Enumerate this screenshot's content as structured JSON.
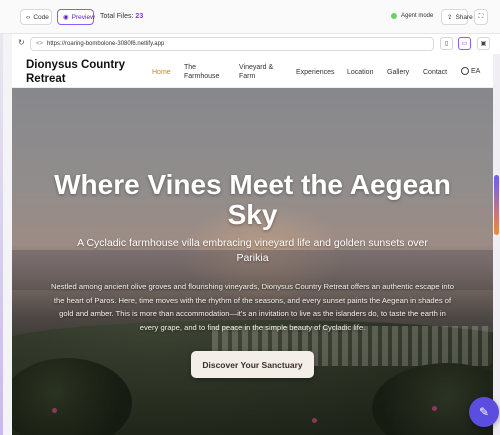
{
  "toolbar": {
    "code_label": "Code",
    "preview_label": "Preview",
    "files_label": "Total Files:",
    "files_count": "23",
    "agent_label": "Agent mode",
    "share_label": "Share"
  },
  "browser": {
    "url": "https://roaring-bombolone-3080f6.netlify.app"
  },
  "site": {
    "brand": "Dionysus Country Retreat",
    "nav": {
      "home": "Home",
      "farmhouse": "The Farmhouse",
      "vineyard": "Vineyard & Farm",
      "experiences": "Experiences",
      "location": "Location",
      "gallery": "Gallery",
      "contact": "Contact",
      "language": "EA"
    },
    "active_color": "#c8862a"
  },
  "hero": {
    "title": "Where Vines Meet the Aegean Sky",
    "subtitle": "A Cycladic farmhouse villa embracing vineyard life and golden sunsets over Parikia",
    "body": "Nestled among ancient olive groves and flourishing vineyards, Dionysus Country Retreat offers an authentic escape into the heart of Paros. Here, time moves with the rhythm of the seasons, and every sunset paints the Aegean in shades of gold and amber. This is more than accommodation—it's an invitation to live as the islanders do, to taste the earth in every grape, and to find peace in the simple beauty of Cycladic life.",
    "cta_label": "Discover Your Sanctuary"
  },
  "icons": {
    "code": "code-icon",
    "preview": "eye-icon",
    "share": "share-icon",
    "more": "expand-icon",
    "reload": "reload-icon",
    "phone": "phone-icon",
    "tablet": "tablet-icon",
    "desktop": "desktop-icon",
    "globe": "globe-icon",
    "fab": "chat-icon"
  }
}
